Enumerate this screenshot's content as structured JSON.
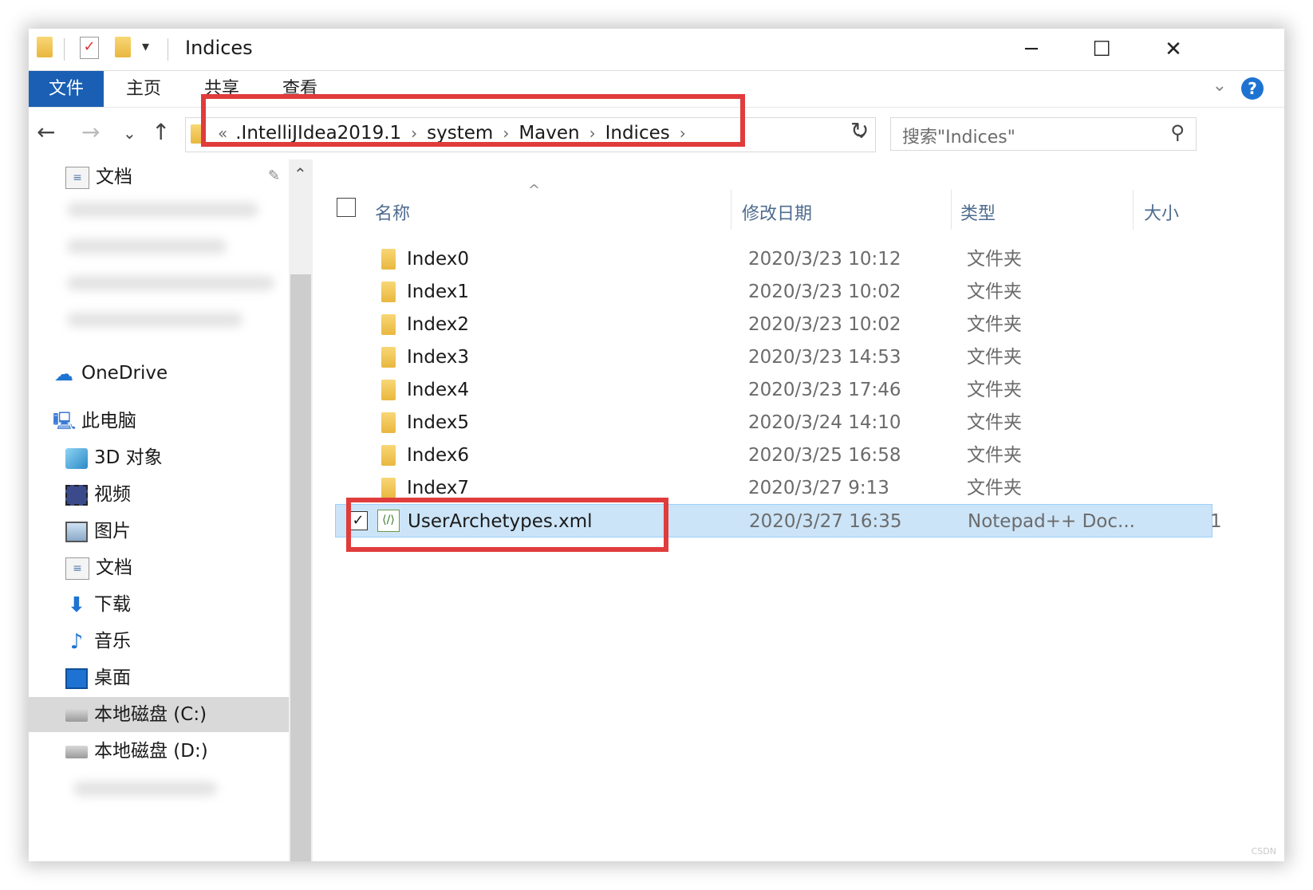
{
  "window": {
    "title": "Indices"
  },
  "titlebar": {
    "minimize": "─",
    "maximize": "☐",
    "close": "✕"
  },
  "ribbon": {
    "tabs": [
      "文件",
      "主页",
      "共享",
      "查看"
    ]
  },
  "address": {
    "lead": "«",
    "crumbs": [
      ".IntelliJIdea2019.1",
      "system",
      "Maven",
      "Indices"
    ],
    "separator": "›"
  },
  "search": {
    "placeholder": "搜索\"Indices\""
  },
  "sidebar": {
    "quick_access_item": "文档",
    "onedrive": "OneDrive",
    "this_pc": "此电脑",
    "items": [
      "3D 对象",
      "视频",
      "图片",
      "文档",
      "下载",
      "音乐",
      "桌面",
      "本地磁盘 (C:)",
      "本地磁盘 (D:)"
    ],
    "selected_index": 7
  },
  "columns": {
    "name": "名称",
    "date": "修改日期",
    "type": "类型",
    "size": "大小"
  },
  "files": [
    {
      "name": "Index0",
      "date": "2020/3/23 10:12",
      "type": "文件夹",
      "size": ""
    },
    {
      "name": "Index1",
      "date": "2020/3/23 10:02",
      "type": "文件夹",
      "size": ""
    },
    {
      "name": "Index2",
      "date": "2020/3/23 10:02",
      "type": "文件夹",
      "size": ""
    },
    {
      "name": "Index3",
      "date": "2020/3/23 14:53",
      "type": "文件夹",
      "size": ""
    },
    {
      "name": "Index4",
      "date": "2020/3/23 17:46",
      "type": "文件夹",
      "size": ""
    },
    {
      "name": "Index5",
      "date": "2020/3/24 14:10",
      "type": "文件夹",
      "size": ""
    },
    {
      "name": "Index6",
      "date": "2020/3/25 16:58",
      "type": "文件夹",
      "size": ""
    },
    {
      "name": "Index7",
      "date": "2020/3/27 9:13",
      "type": "文件夹",
      "size": ""
    },
    {
      "name": "UserArchetypes.xml",
      "date": "2020/3/27 16:35",
      "type": "Notepad++ Doc...",
      "size": "1"
    }
  ],
  "selected_file": "UserArchetypes.xml",
  "colors": {
    "accent": "#1a5fb4",
    "highlight": "#e03c3c",
    "selection": "#cce4f7"
  }
}
